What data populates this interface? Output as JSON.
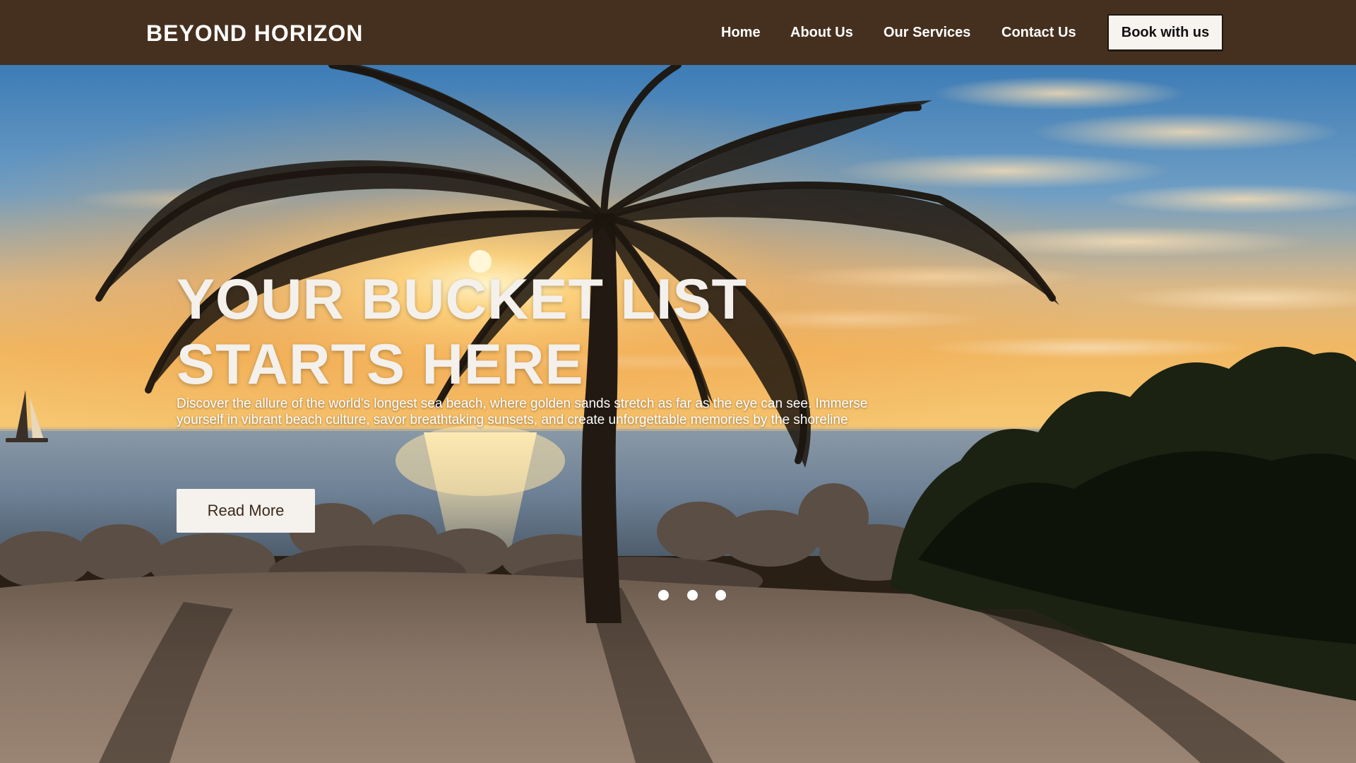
{
  "header": {
    "brand": "BEYOND HORIZON",
    "nav": {
      "home": "Home",
      "about": "About Us",
      "services": "Our Services",
      "contact": "Contact Us"
    },
    "cta_label": "Book with us"
  },
  "hero": {
    "title_line1": "YOUR BUCKET LIST",
    "title_line2": "STARTS HERE",
    "description": "Discover the allure of the world's longest sea beach, where golden sands stretch as far as the eye can see. Immerse yourself in vibrant beach culture, savor breathtaking sunsets, and create unforgettable memories by the shoreline",
    "read_more_label": "Read More",
    "slides_count": 3
  },
  "colors": {
    "navbar_bg": "#45301f",
    "button_bg": "#f7f3ef",
    "text_light": "#ffffff",
    "sky_top": "#3f7fb9",
    "sun_glow": "#ffd27a"
  }
}
